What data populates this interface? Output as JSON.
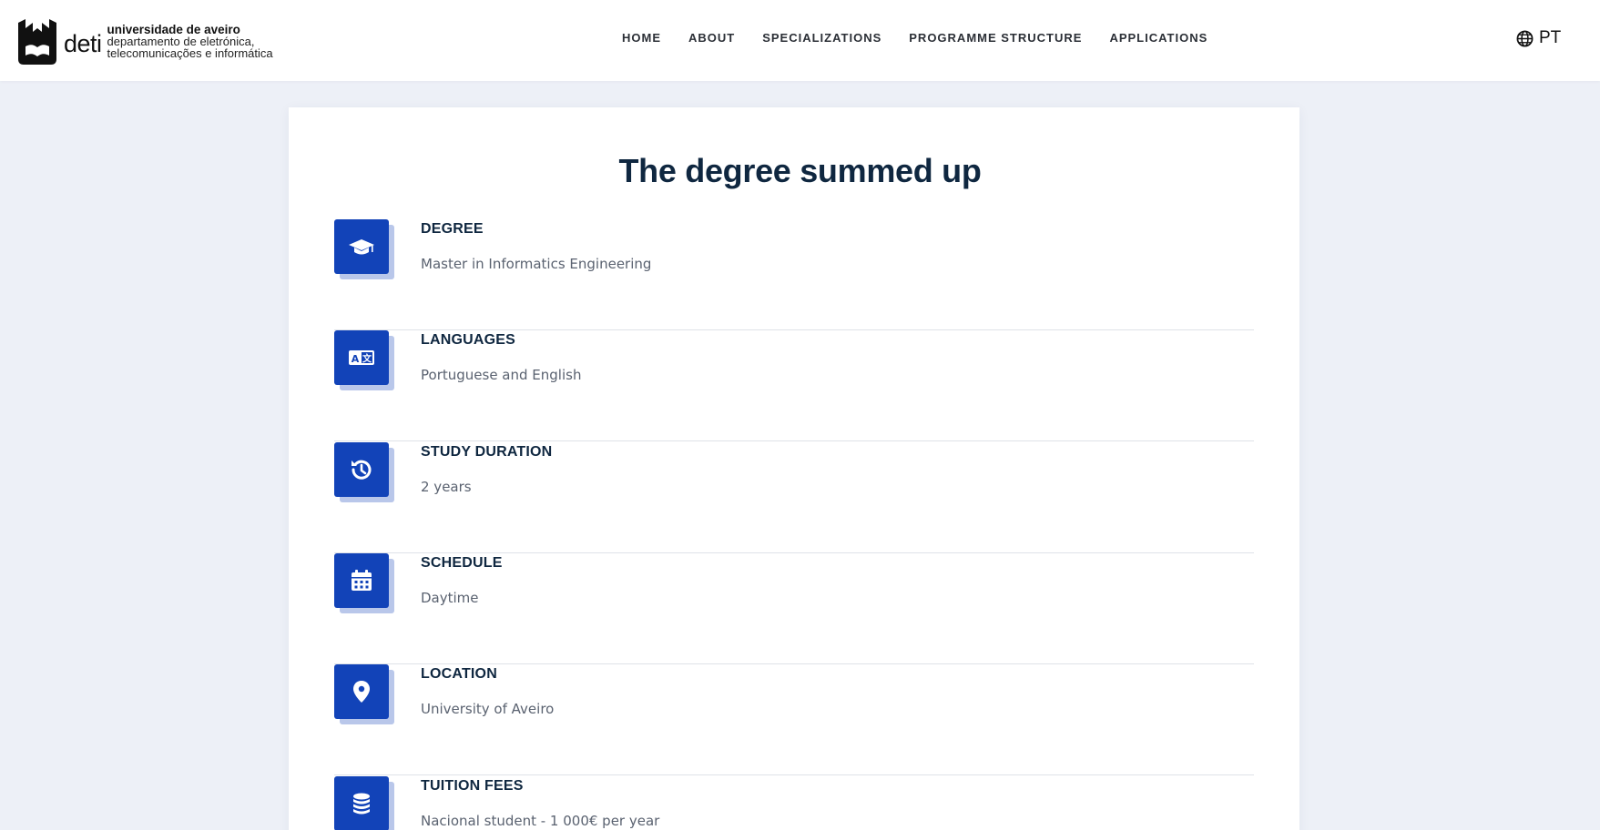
{
  "header": {
    "brand": {
      "short": "deti",
      "university": "universidade de aveiro",
      "department_line1": "departamento de eletrónica,",
      "department_line2": "telecomunicações e informática"
    },
    "nav": [
      {
        "label": "HOME"
      },
      {
        "label": "ABOUT"
      },
      {
        "label": "SPECIALIZATIONS"
      },
      {
        "label": "PROGRAMME STRUCTURE"
      },
      {
        "label": "APPLICATIONS"
      }
    ],
    "language": {
      "label": "PT",
      "icon": "globe-icon"
    }
  },
  "summary": {
    "title": "The degree summed up",
    "rows": [
      {
        "label": "DEGREE",
        "value": "Master in Informatics Engineering",
        "icon": "graduation-cap-icon"
      },
      {
        "label": "LANGUAGES",
        "value": "Portuguese and English",
        "icon": "language-icon"
      },
      {
        "label": "STUDY DURATION",
        "value": "2 years",
        "icon": "history-icon"
      },
      {
        "label": "SCHEDULE",
        "value": "Daytime",
        "icon": "calendar-icon"
      },
      {
        "label": "LOCATION",
        "value": "University of Aveiro",
        "icon": "map-pin-icon"
      },
      {
        "label": "TUITION FEES",
        "value": "Nacional student - 1 000€ per year",
        "icon": "coins-icon"
      }
    ]
  },
  "colors": {
    "accent": "#1243b8",
    "accent_shadow": "#b9c7ea",
    "page_background": "#edf0f7",
    "heading": "#0f2740",
    "body_text": "#5a6270"
  }
}
